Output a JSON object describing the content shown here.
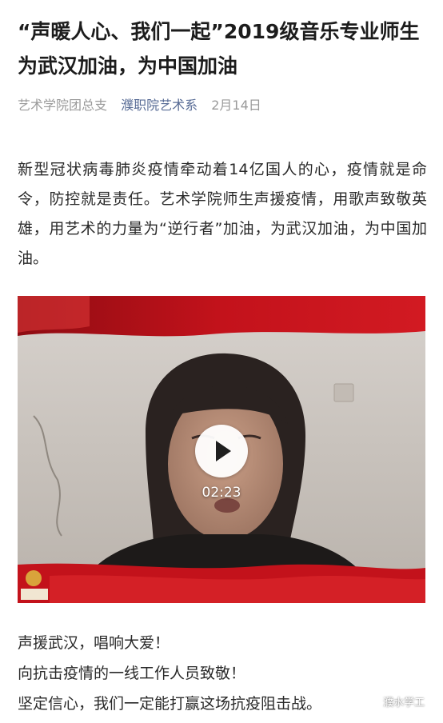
{
  "article": {
    "title": "“声暖人心、我们一起”2019级音乐专业师生为武汉加油，为中国加油",
    "author": "艺术学院团总支",
    "account": "濮职院艺术系",
    "date": "2月14日",
    "intro": "新型冠状病毒肺炎疫情牵动着14亿国人的心，疫情就是命令，防控就是责任。艺术学院师生声援疫情，用歌声致敬英雄，用艺术的力量为“逆行者”加油，为武汉加油，为中国加油。"
  },
  "video": {
    "duration": "02:23",
    "play_icon": "play-icon"
  },
  "outro": {
    "lines": [
      "声援武汉，唱响大爱！",
      "向抗击疫情的一线工作人员致敬！",
      "坚定信心，我们一定能打赢这场抗疫阻击战。"
    ]
  },
  "watermark": {
    "text": "濮水学工",
    "icon": "wechat-icon"
  },
  "colors": {
    "account_link": "#576b95",
    "meta_gray": "#9a9a9a",
    "flag_red": "#c3121b"
  }
}
